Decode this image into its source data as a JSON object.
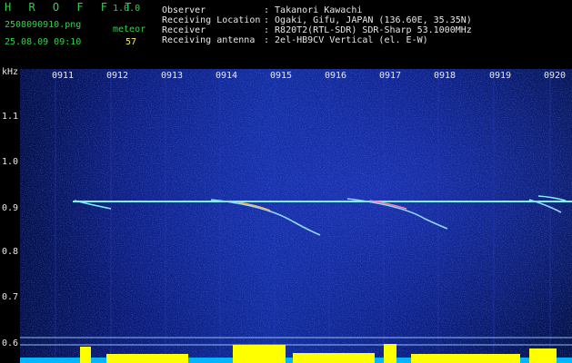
{
  "header": {
    "app_title": "H R O F F T",
    "version": "1.0.0",
    "filename": "2508090910.png",
    "timestamp": "25.08.09 09:10",
    "detection_label": "meteor",
    "detection_count": "57",
    "fields": [
      {
        "label": "Observer",
        "value": ": Takanori Kawachi"
      },
      {
        "label": "Receiving Location",
        "value": ": Ogaki, Gifu, JAPAN (136.60E, 35.35N)"
      },
      {
        "label": "Receiver",
        "value": ": R820T2(RTL-SDR) SDR-Sharp 53.1000MHz"
      },
      {
        "label": "Receiving antenna",
        "value": ": 2el-HB9CV Vertical (el. E-W)"
      }
    ]
  },
  "axis": {
    "unit": "kHz",
    "y_ticks": [
      "1.1",
      "1.0",
      "0.9",
      "0.8",
      "0.7",
      "0.6"
    ],
    "x_ticks": [
      "0911",
      "0912",
      "0913",
      "0914",
      "0915",
      "0916",
      "0917",
      "0918",
      "0919",
      "0920"
    ]
  },
  "colors": {
    "header_green": "#2fd24a",
    "header_yellow": "#f3f35a",
    "carrier_cyan": "#7ef3ff",
    "activity_yellow": "#ffff00"
  }
}
